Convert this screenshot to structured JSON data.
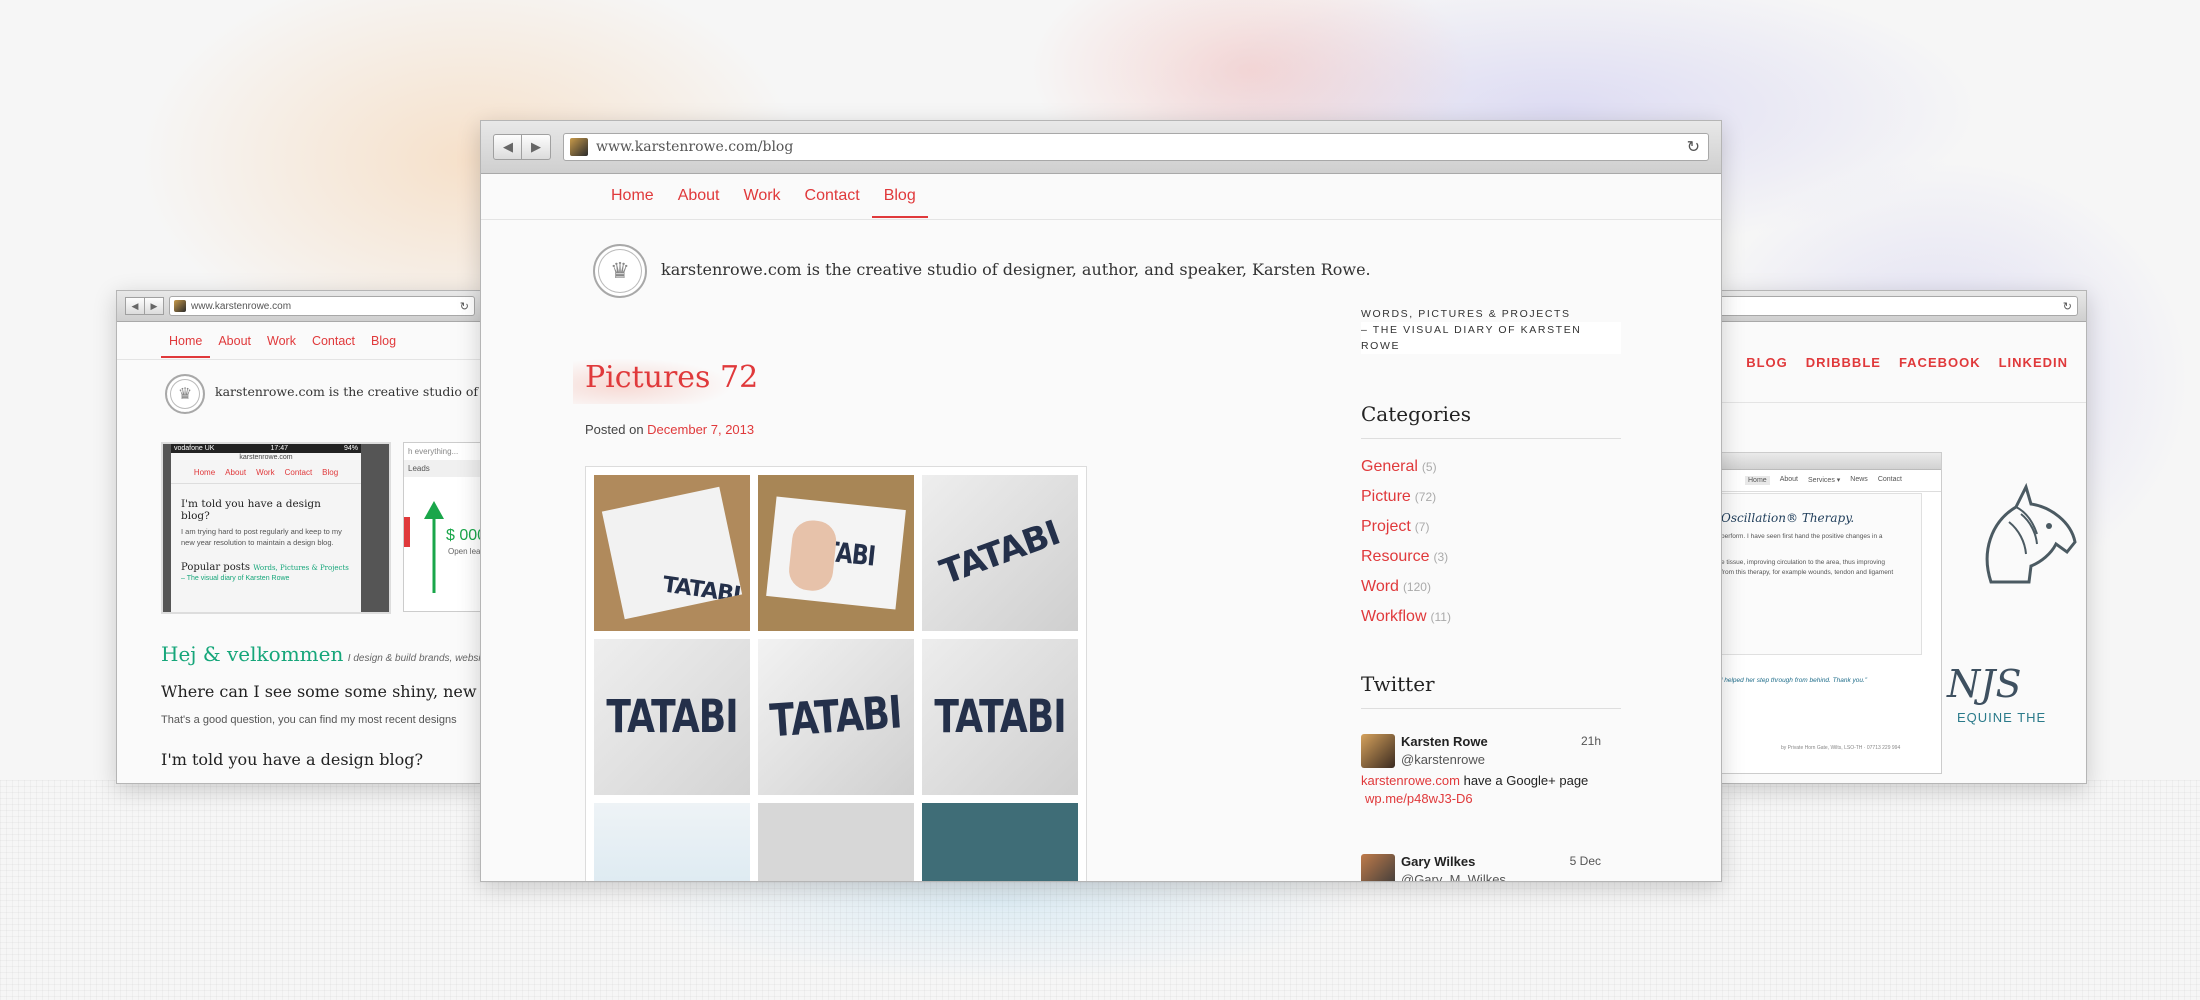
{
  "main_window": {
    "url": "www.karstenrowe.com/blog",
    "nav": [
      "Home",
      "About",
      "Work",
      "Contact",
      "Blog"
    ],
    "active_nav": "Blog",
    "tagline": "karstenrowe.com is the creative studio of designer, author, and speaker, Karsten Rowe.",
    "post": {
      "title": "Pictures 72",
      "posted_prefix": "Posted on",
      "posted_date": "December 7, 2013",
      "tile_word": "TATABI"
    },
    "sidebar": {
      "tag_line1": "WORDS, PICTURES & PROJECTS",
      "tag_line2": "– THE VISUAL DIARY OF KARSTEN ROWE",
      "categories_heading": "Categories",
      "categories": [
        {
          "name": "General",
          "count": "(5)"
        },
        {
          "name": "Picture",
          "count": "(72)"
        },
        {
          "name": "Project",
          "count": "(7)"
        },
        {
          "name": "Resource",
          "count": "(3)"
        },
        {
          "name": "Word",
          "count": "(120)"
        },
        {
          "name": "Workflow",
          "count": "(11)"
        }
      ],
      "twitter_heading": "Twitter",
      "tweets": [
        {
          "name": "Karsten Rowe",
          "handle": "@karstenrowe",
          "time": "21h",
          "link1": "karstenrowe.com",
          "text": " have a Google+ page",
          "link2": "wp.me/p48wJ3-D6"
        },
        {
          "name": "Gary Wilkes",
          "handle": "@Gary_M_Wilkes",
          "time": "5 Dec"
        }
      ]
    }
  },
  "left_window": {
    "url": "www.karstenrowe.com",
    "nav": [
      "Home",
      "About",
      "Work",
      "Contact",
      "Blog"
    ],
    "tagline": "karstenrowe.com is the creative studio of design",
    "phone": {
      "carrier": "vodafone UK",
      "time": "17:47",
      "battery": "94%",
      "site": "karstenrowe.com",
      "nav": [
        "Home",
        "About",
        "Work",
        "Contact",
        "Blog"
      ],
      "heading": "I'm told you have a design blog?",
      "text": "I am trying hard to post regularly and keep to my new year resolution to maintain a design blog.",
      "popular": "Popular posts",
      "popular_link": "Words, Pictures & Projects",
      "popular_link2": "– The visual diary of Karsten Rowe"
    },
    "card2": {
      "search": "h everything...",
      "leads": "Leads",
      "value": "$ 000",
      "sub": "Open lea"
    },
    "welcome": "Hej & velkommen",
    "welcome_sub": "I design & build brands, websi",
    "question": "Where can I see some some shiny, new desig",
    "answer": "That's a good question, you can find my most recent designs",
    "blog_q": "I'm told you have a design blog?"
  },
  "right_window": {
    "nav": [
      "BLOG",
      "DRIBBBLE",
      "FACEBOOK",
      "LINKEDIN"
    ],
    "inner_nav": [
      "Home",
      "About",
      "Services ▾",
      "News",
      "Contact"
    ],
    "heading": "Oscillation® Therapy.",
    "p1": "perform. I have seen first hand the positive changes in a",
    "p2": "e tissue, improving circulation to the area, thus improving",
    "p3": "from this therapy, for example wounds, tendon and ligament",
    "quote": "l helped her step through from behind. Thank you.”",
    "footer": "by Private Horn Gate, Wilts, LSO-TH · 07713 229 994",
    "logo": "NJS",
    "logo_sub": "EQUINE THE"
  },
  "colors": {
    "accent": "#e0393b",
    "welcome_green": "#16a67a",
    "teal_tile": "#3f6d77"
  }
}
